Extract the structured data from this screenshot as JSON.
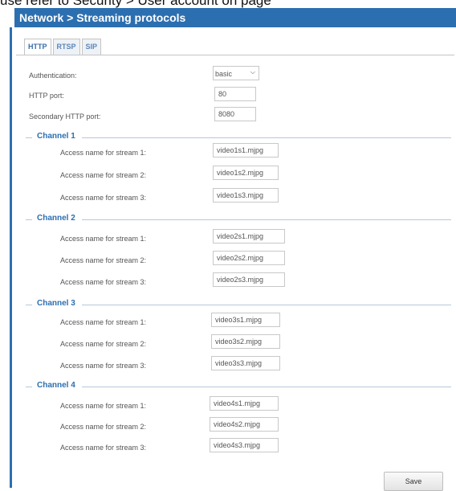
{
  "doc_fragment": "use refer to Security > User account on page",
  "header": {
    "title": "Network > Streaming protocols"
  },
  "tabs": [
    {
      "label": "HTTP",
      "active": true
    },
    {
      "label": "RTSP",
      "active": false
    },
    {
      "label": "SIP",
      "active": false
    }
  ],
  "http": {
    "authentication_label": "Authentication:",
    "authentication_value": "basic",
    "http_port_label": "HTTP port:",
    "http_port_value": "80",
    "secondary_port_label": "Secondary HTTP port:",
    "secondary_port_value": "8080"
  },
  "channels": [
    {
      "title": "Channel 1",
      "streams": [
        {
          "label": "Access name for stream 1:",
          "value": "video1s1.mjpg"
        },
        {
          "label": "Access name for stream 2:",
          "value": "video1s2.mjpg"
        },
        {
          "label": "Access name for stream 3:",
          "value": "video1s3.mjpg"
        }
      ]
    },
    {
      "title": "Channel 2",
      "streams": [
        {
          "label": "Access name for stream 1:",
          "value": "video2s1.mjpg"
        },
        {
          "label": "Access name for stream 2:",
          "value": "video2s2.mjpg"
        },
        {
          "label": "Access name for stream 3:",
          "value": "video2s3.mjpg"
        }
      ]
    },
    {
      "title": "Channel 3",
      "streams": [
        {
          "label": "Access name for stream 1:",
          "value": "video3s1.mjpg"
        },
        {
          "label": "Access name for stream 2:",
          "value": "video3s2.mjpg"
        },
        {
          "label": "Access name for stream 3:",
          "value": "video3s3.mjpg"
        }
      ]
    },
    {
      "title": "Channel 4",
      "streams": [
        {
          "label": "Access name for stream 1:",
          "value": "video4s1.mjpg"
        },
        {
          "label": "Access name for stream 2:",
          "value": "video4s2.mjpg"
        },
        {
          "label": "Access name for stream 3:",
          "value": "video4s3.mjpg"
        }
      ]
    }
  ],
  "footer": {
    "save_label": "Save"
  },
  "colors": {
    "accent": "#2c6fb0",
    "channel_title": "#2c6fb0"
  }
}
